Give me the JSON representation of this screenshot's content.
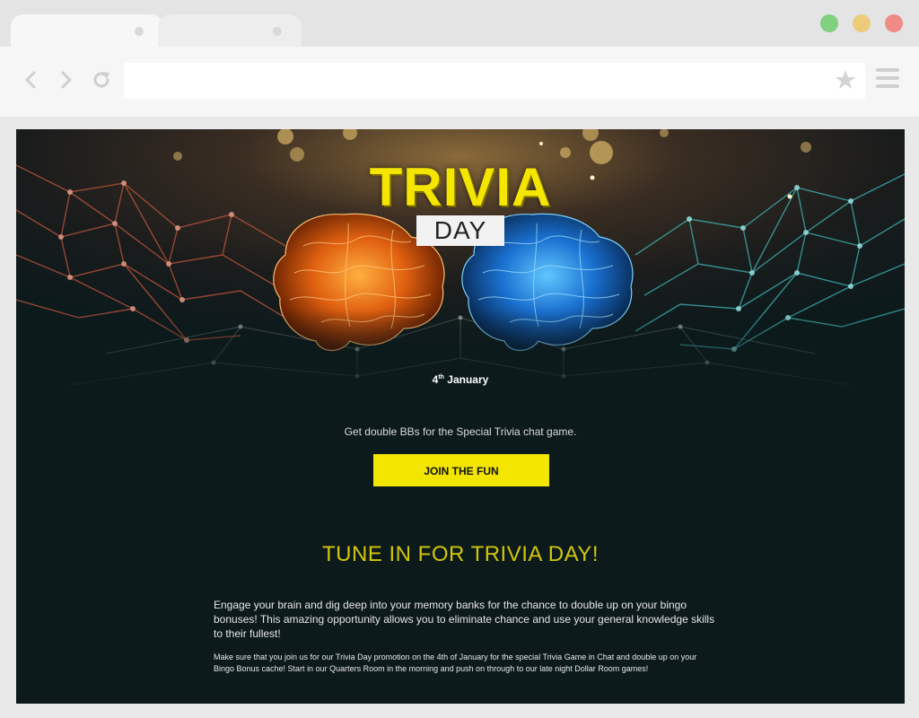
{
  "browser": {
    "window_buttons": {
      "green": "#7fd17f",
      "yellow": "#eccb7b",
      "red": "#f08a86"
    },
    "icons": {
      "back": "chevron-left-icon",
      "forward": "chevron-right-icon",
      "reload": "reload-icon",
      "bookmark": "star-icon",
      "menu": "hamburger-menu-icon"
    },
    "address_value": ""
  },
  "page": {
    "logo": {
      "title": "TRIVIA",
      "subtitle": "DAY"
    },
    "date": {
      "day": "4",
      "suffix": "th",
      "month": "January"
    },
    "promo_text": "Get double BBs for the Special Trivia chat game.",
    "cta_label": "JOIN THE FUN",
    "section_heading": "TUNE IN FOR TRIVIA DAY!",
    "paragraph_1": "Engage your brain and dig deep into your memory banks for the chance to double up on your bingo bonuses! This amazing opportunity allows you to eliminate chance and use your general knowledge skills to their fullest!",
    "paragraph_2": " Make sure that you join us for our Trivia Day promotion on the 4th of January for the special Trivia Game in Chat and double up on your Bingo Bonus cache! Start in our Quarters Room in the morning and push on through to our late night Dollar Room games!",
    "colors": {
      "accent_yellow": "#f2e600",
      "heading_gold": "#d1c70a",
      "page_bg": "#0d1a1c",
      "brain_left": "#ff7a12",
      "brain_right": "#1e8ff0"
    }
  }
}
